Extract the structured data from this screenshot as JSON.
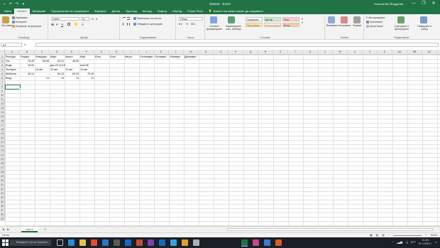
{
  "window": {
    "title": "Книга1 - Excel",
    "user": "Константин Йорданов",
    "controls": [
      "—",
      "❐",
      "✕"
    ]
  },
  "ribbon_tabs": [
    "Файл",
    "Начало",
    "Вмъкване",
    "Оформление на страницата",
    "Формули",
    "Данни",
    "Преглед",
    "Изглед",
    "Помощ",
    "Disk.bg",
    "Power Pivot"
  ],
  "tell_me": "Кажете ми какво искате да направите",
  "ribbon": {
    "clipboard": {
      "paste": "Поставяне",
      "cut": "Изрязване",
      "copy": "Копиране",
      "painter": "Копиране на формати",
      "label": "Клипборд"
    },
    "font": {
      "name": "Calibri",
      "size": "11",
      "label": "Шрифт"
    },
    "alignment": {
      "wrap": "Пренасяне на текста",
      "merge": "Обедини и центрирай",
      "label": "Подравняване"
    },
    "number": {
      "format": "Общи",
      "label": "Число"
    },
    "styles": {
      "conditional": "Условно форматиране",
      "as_table": "Форматиране като таблица",
      "normal": "Нормален",
      "bad": "Лош",
      "neutral": "Неутрален",
      "good": "Добър",
      "calc": "Изчисляване",
      "check": "Клетка за проверка",
      "input": "Вход",
      "label": "Стилове"
    },
    "cells": {
      "insert": "Вмъкване",
      "delete": "Изтриване",
      "format": "Формат",
      "label": "Клетки"
    },
    "editing": {
      "autosum": "Автосумиране",
      "fill": "Запълване",
      "clear": "Изчистване",
      "sort": "Сортиране и филтриране",
      "find": "Намиране и избор",
      "label": "Редактиране"
    }
  },
  "formula_bar": {
    "name_box": "A7",
    "fx": "fx",
    "value": ""
  },
  "columns": [
    "A",
    "B",
    "C",
    "D",
    "E",
    "F",
    "G",
    "H",
    "I",
    "J",
    "K",
    "L",
    "M",
    "N",
    "O",
    "P",
    "Q",
    "R",
    "S",
    "T",
    "U",
    "V",
    "W",
    "X",
    "Y",
    "Z",
    "AA",
    "AB",
    "AC",
    "AD"
  ],
  "rows": [
    "1",
    "2",
    "3",
    "4",
    "5",
    "6",
    "7",
    "8",
    "9",
    "10",
    "11",
    "12",
    "13",
    "14",
    "15",
    "16",
    "17",
    "18",
    "19",
    "20",
    "21",
    "22",
    "23",
    "24",
    "25",
    "26",
    "27",
    "28",
    "29",
    "30",
    "31",
    "32",
    "33",
    "34",
    "35",
    "36",
    "37",
    "38",
    "39"
  ],
  "cells": {
    "header": [
      "Разходи",
      "Януари",
      "Февруари",
      "Март",
      "Април",
      "Май",
      "Юни",
      "Юли",
      "Август",
      "Септември",
      "Октомври",
      "Ноември",
      "Декември"
    ],
    "r2": [
      "Ток",
      "76.45",
      "56.98",
      "54.12",
      "48.82"
    ],
    "r3": [
      "Вода",
      "16.60",
      "",
      "дек.43 15.18",
      "",
      "юни.56"
    ],
    "r4": [
      "Телефон",
      "",
      "13.авг",
      "12.авг",
      "12.авг",
      "13.авг"
    ],
    "r5": [
      "Мобилни",
      "46.12",
      "",
      "54.23",
      "65.23",
      "78.45"
    ],
    "r6": [
      "Вход",
      "",
      "14",
      "14",
      "14",
      "14"
    ]
  },
  "sheet": {
    "tab": "Лист1",
    "add": "+"
  },
  "status": {
    "left": "Готов",
    "zoom": "100%"
  },
  "taskbar": {
    "search": "Въведете тук за търсене",
    "time": "21:36",
    "date": "01.4.2019 г.",
    "lang": "БГР"
  }
}
